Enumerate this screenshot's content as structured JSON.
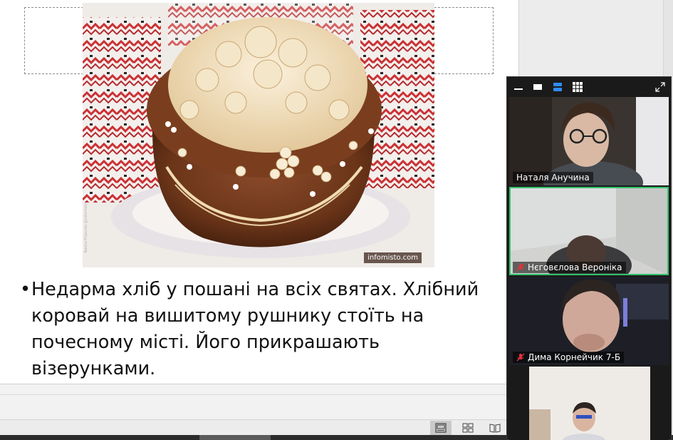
{
  "slide": {
    "image_source_label": "infomisto.com",
    "image_vertical_credit": "Nastia Pilipenko @infomisto",
    "bullet_symbol": "•",
    "bullet_text": "Недарма хліб у пошані на всіх святах. Хлібний коровай на вишитому рушнику стоїть на почесному місті. Його прикрашають візерунками."
  },
  "zoom": {
    "participants": [
      {
        "name": "Наталя Анучина",
        "muted": false
      },
      {
        "name": "Нєговєлова Вероніка",
        "muted": true,
        "active_speaker": true
      },
      {
        "name": "Дима Корнейчик 7-Б",
        "muted": true
      },
      {
        "name": "",
        "muted": false
      }
    ],
    "active_view": "speaker-strip"
  },
  "colors": {
    "active_speaker_border": "#32c36a",
    "mute_icon": "#e0323c",
    "view_icon_active": "#2d8cff"
  }
}
